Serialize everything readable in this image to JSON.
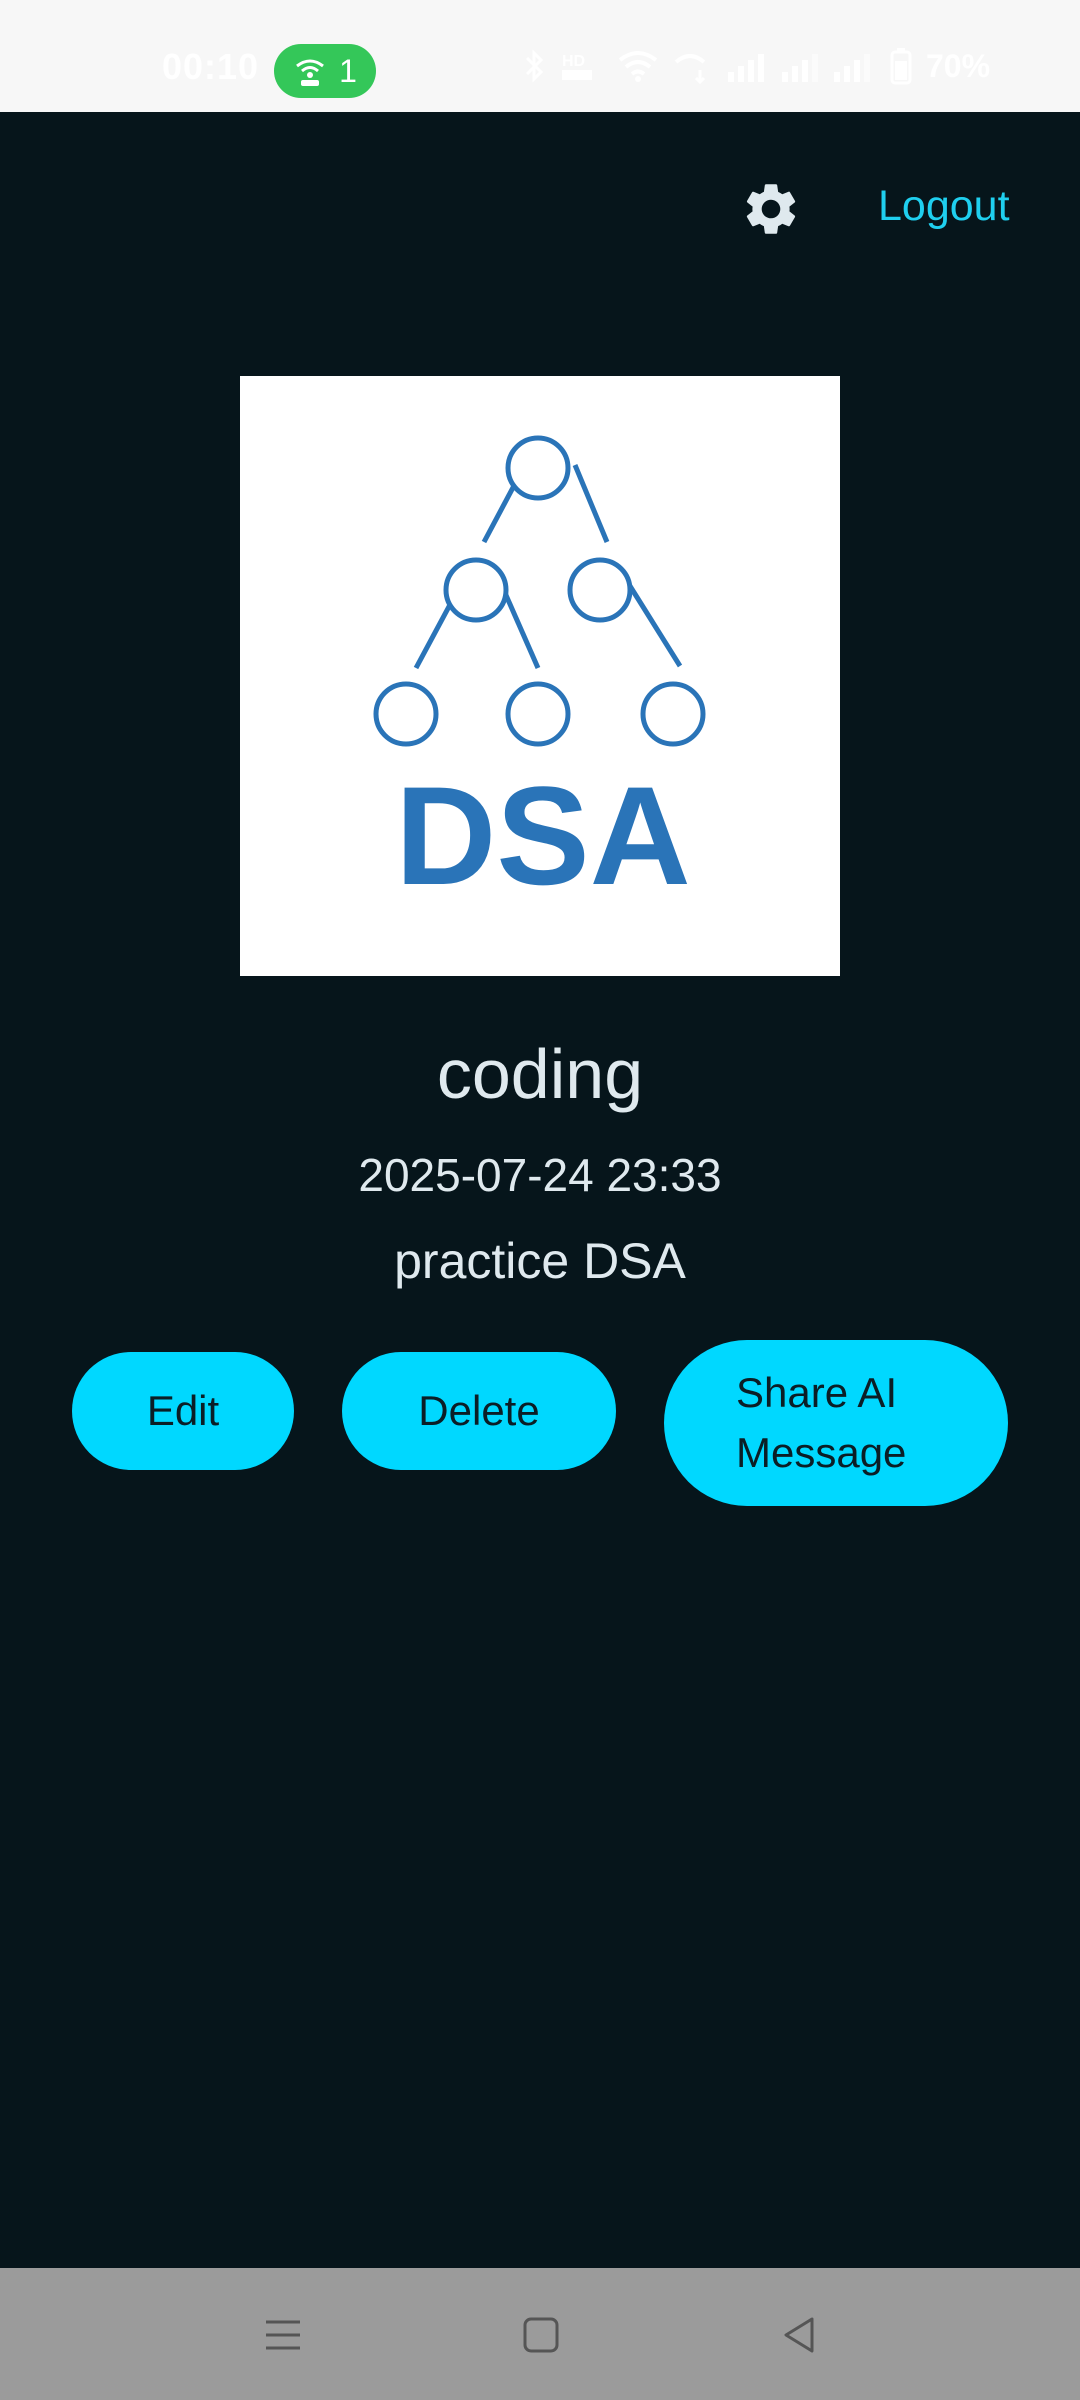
{
  "status_bar": {
    "time": "00:10",
    "hotspot_count": "1",
    "battery": "70%",
    "icons": [
      "bluetooth-icon",
      "volte-icon",
      "wifi-icon",
      "data-icon",
      "signal-icon",
      "battery-icon"
    ]
  },
  "header": {
    "settings_icon": "gear-icon",
    "logout_label": "Logout"
  },
  "card": {
    "logo_text": "DSA",
    "title": "coding",
    "datetime": "2025-07-24 23:33",
    "description": "practice DSA"
  },
  "actions": {
    "edit_label": "Edit",
    "delete_label": "Delete",
    "share_label_line1": "Share AI",
    "share_label_line2": "Message"
  },
  "nav": {
    "icons": [
      "menu-icon",
      "home-icon",
      "back-icon"
    ]
  },
  "colors": {
    "background": "#06151b",
    "accent": "#00d8ff",
    "link": "#1fcfef",
    "logo_blue": "#2a74b8"
  }
}
